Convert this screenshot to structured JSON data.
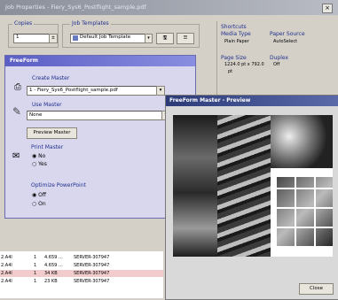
{
  "window": {
    "title": "Job Properties - Fiery_Sys6_Postflight_sample.pdf",
    "close": "×"
  },
  "copies": {
    "label": "Copies",
    "value": "1"
  },
  "templates": {
    "label": "Job Templates",
    "value": "Default Job Template"
  },
  "shortcuts": {
    "title": "Shortcuts",
    "media_type_label": "Media Type",
    "media_type_value": "Plain Paper",
    "paper_source_label": "Paper Source",
    "paper_source_value": "AutoSelect",
    "page_size_label": "Page Size",
    "page_size_value": "1224.0 pt x 792.0",
    "page_size_unit": "pt",
    "duplex_label": "Duplex",
    "duplex_value": "Off"
  },
  "freeform": {
    "header": "FreeForm",
    "create_master_label": "Create Master",
    "create_master_value": "1 - Fiery_Sys6_Postflight_sample.pdf",
    "use_master_label": "Use Master",
    "use_master_value": "None",
    "preview_master_button": "Preview Master",
    "print_master_label": "Print Master",
    "print_master_no": "No",
    "print_master_yes": "Yes",
    "optimize_label": "Optimize PowerPoint",
    "optimize_off": "Off",
    "optimize_on": "On"
  },
  "preview": {
    "title": "FreeForm Master - Preview",
    "close_button": "Close"
  },
  "log": {
    "rows": [
      {
        "a": "2.A4l",
        "b": "1",
        "c": "4.659 ...",
        "d": "SERVER-307947"
      },
      {
        "a": "2.A4l",
        "b": "1",
        "c": "4.659 ...",
        "d": "SERVER-307947"
      },
      {
        "a": "2.A4l",
        "b": "1",
        "c": "34 KB",
        "d": "SERVER-307947"
      },
      {
        "a": "2.A4l",
        "b": "1",
        "c": "23 KB",
        "d": "SERVER-307947"
      }
    ]
  }
}
